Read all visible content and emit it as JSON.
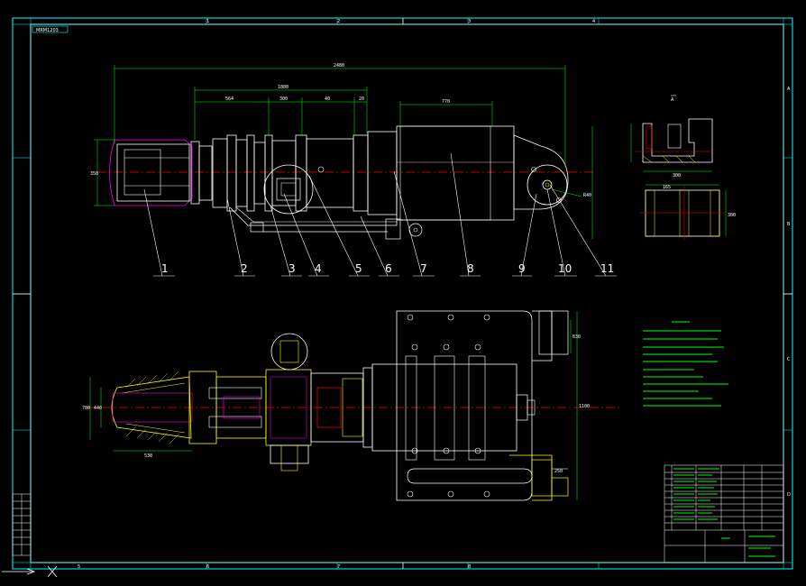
{
  "drawing": {
    "title_tag": "MRM1203",
    "section_marker": "A",
    "part_balloons": [
      "1",
      "2",
      "3",
      "4",
      "5",
      "6",
      "7",
      "8",
      "9",
      "10",
      "11"
    ],
    "dimensions": {
      "overall_length": "2480",
      "length_1": "1800",
      "length_2": "564",
      "length_3": "300",
      "length_4": "20",
      "length_5": "40",
      "length_6": "770",
      "height_left": "350",
      "radius": "R40",
      "plan_width": "780",
      "detail_width": "300",
      "detail_height": "300",
      "detail_top": "165",
      "plan_side_1": "440",
      "plan_side_2": "530",
      "plan_side_3": "830",
      "plan_right": "1100",
      "lug_width": "250"
    },
    "frame_zone_labels": [
      "1",
      "2",
      "3",
      "4",
      "5",
      "6",
      "7",
      "8"
    ],
    "frame_row_labels": [
      "A",
      "B",
      "C",
      "D"
    ],
    "colors": {
      "frame": "#00ffff",
      "geometry": "#ffffff",
      "centerline": "#ff0000",
      "dimension": "#00ff00",
      "hatch": "#ffff00",
      "hidden": "#ff00ff",
      "background": "#000000"
    }
  }
}
